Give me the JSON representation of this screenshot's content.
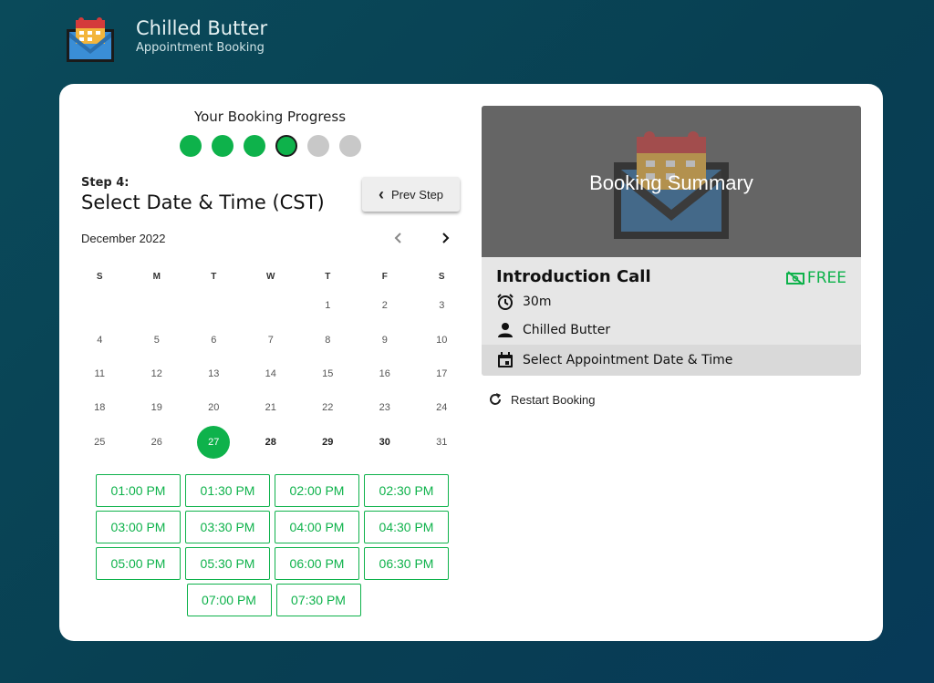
{
  "brand": {
    "title": "Chilled Butter",
    "subtitle": "Appointment Booking",
    "logo_icon": "envelope-calendar-logo"
  },
  "progress": {
    "title": "Your Booking Progress",
    "total_steps": 6,
    "completed_steps": 3,
    "current_step": 4
  },
  "step": {
    "label": "Step 4:",
    "title": "Select Date & Time (CST)"
  },
  "prev_button": {
    "label": "Prev Step",
    "icon": "chevron-left-icon"
  },
  "calendar": {
    "month_label": "December 2022",
    "weekday_headers": [
      "S",
      "M",
      "T",
      "W",
      "T",
      "F",
      "S"
    ],
    "weeks": [
      [
        "",
        "",
        "",
        "",
        "1",
        "2",
        "3"
      ],
      [
        "4",
        "5",
        "6",
        "7",
        "8",
        "9",
        "10"
      ],
      [
        "11",
        "12",
        "13",
        "14",
        "15",
        "16",
        "17"
      ],
      [
        "18",
        "19",
        "20",
        "21",
        "22",
        "23",
        "24"
      ],
      [
        "25",
        "26",
        "27",
        "28",
        "29",
        "30",
        "31"
      ]
    ],
    "selected_day": "27",
    "available_days": [
      "28",
      "29",
      "30"
    ]
  },
  "time_slots": {
    "rows": [
      [
        "01:00 PM",
        "01:30 PM",
        "02:00 PM",
        "02:30 PM"
      ],
      [
        "03:00 PM",
        "03:30 PM",
        "04:00 PM",
        "04:30 PM"
      ],
      [
        "05:00 PM",
        "05:30 PM",
        "06:00 PM",
        "06:30 PM"
      ],
      [
        "07:00 PM",
        "07:30 PM"
      ]
    ]
  },
  "summary": {
    "hero_title": "Booking Summary",
    "appointment_name": "Introduction Call",
    "price": "FREE",
    "duration": "30m",
    "provider": "Chilled Butter",
    "date_time": "Select Appointment Date & Time"
  },
  "restart": {
    "label": "Restart Booking",
    "icon": "refresh-icon"
  },
  "colors": {
    "accent": "#0eb24b",
    "header_bg": "#0a4a5a",
    "summary_hero_bg": "#656565",
    "summary_bg": "#e6e6e6"
  }
}
